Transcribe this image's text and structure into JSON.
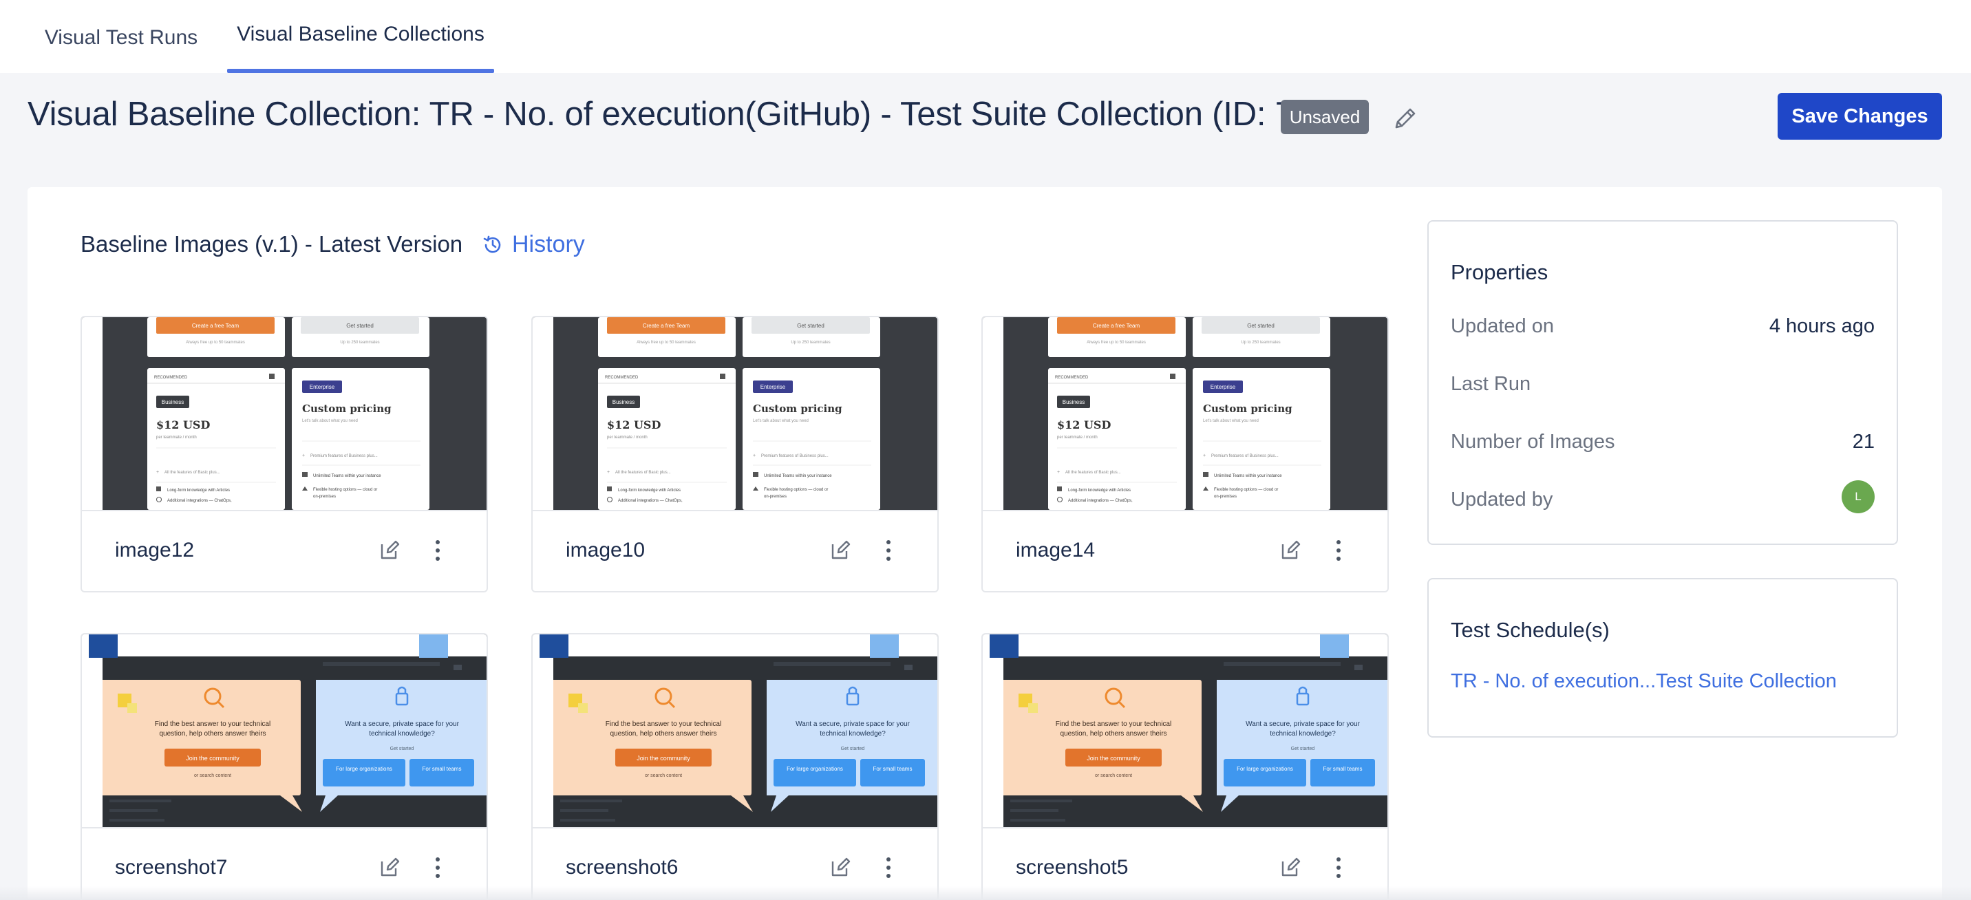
{
  "tabs": [
    {
      "label": "Visual Test Runs",
      "active": false
    },
    {
      "label": "Visual Baseline Collections",
      "active": true
    }
  ],
  "header": {
    "title": "Visual Baseline Collection: TR - No. of execution(GitHub) - Test Suite Collection (ID: 7)",
    "status_badge": "Unsaved",
    "save_label": "Save Changes"
  },
  "baseline": {
    "section_title": "Baseline Images (v.1) - Latest Version",
    "history_label": "History",
    "images": [
      {
        "name": "image12",
        "kind": "pricing"
      },
      {
        "name": "image10",
        "kind": "pricing"
      },
      {
        "name": "image14",
        "kind": "pricing"
      },
      {
        "name": "screenshot7",
        "kind": "community"
      },
      {
        "name": "screenshot6",
        "kind": "community"
      },
      {
        "name": "screenshot5",
        "kind": "community"
      }
    ]
  },
  "thumb_text": {
    "create_team": "Create a free Team",
    "get_started": "Get started",
    "free_up": "Always free up to 50 teammates",
    "up_to": "Up to 250 teammates",
    "recommended": "RECOMMENDED",
    "business": "Business",
    "price": "$12 USD",
    "per": "per teammate / month",
    "enterprise": "Enterprise",
    "custom": "Custom pricing",
    "talk": "Let's talk about what you need",
    "b1": "All the features of Basic plus...",
    "b2": "Long-form knowledge with Articles",
    "b3": "Additional integrations — ChatOps,",
    "e1": "Premium features of Business plus...",
    "e2": "Unlimited Teams within your instance",
    "e3": "Flexible hosting options — cloud or",
    "e4": "on-premises",
    "c_left_1": "Find the best answer to your technical",
    "c_left_2": "question, help others answer theirs",
    "join": "Join the community",
    "or_search": "or search content",
    "c_right_1": "Want a secure, private space for your",
    "c_right_2": "technical knowledge?",
    "c_right_get": "Get started",
    "large_orgs": "For large organizations",
    "small_teams": "For small teams"
  },
  "properties": {
    "title": "Properties",
    "rows": [
      {
        "label": "Updated on",
        "value": "4 hours ago"
      },
      {
        "label": "Last Run",
        "value": ""
      },
      {
        "label": "Number of Images",
        "value": "21"
      },
      {
        "label": "Updated by",
        "value": ""
      }
    ],
    "avatar_initial": "L"
  },
  "schedules": {
    "title": "Test Schedule(s)",
    "link": "TR - No. of execution...Test Suite Collection"
  },
  "colors": {
    "accent": "#4f74e3",
    "primary_button": "#1f47c8",
    "badge": "#6b7280",
    "link": "#3f6fe0",
    "avatar": "#6aa84f"
  }
}
